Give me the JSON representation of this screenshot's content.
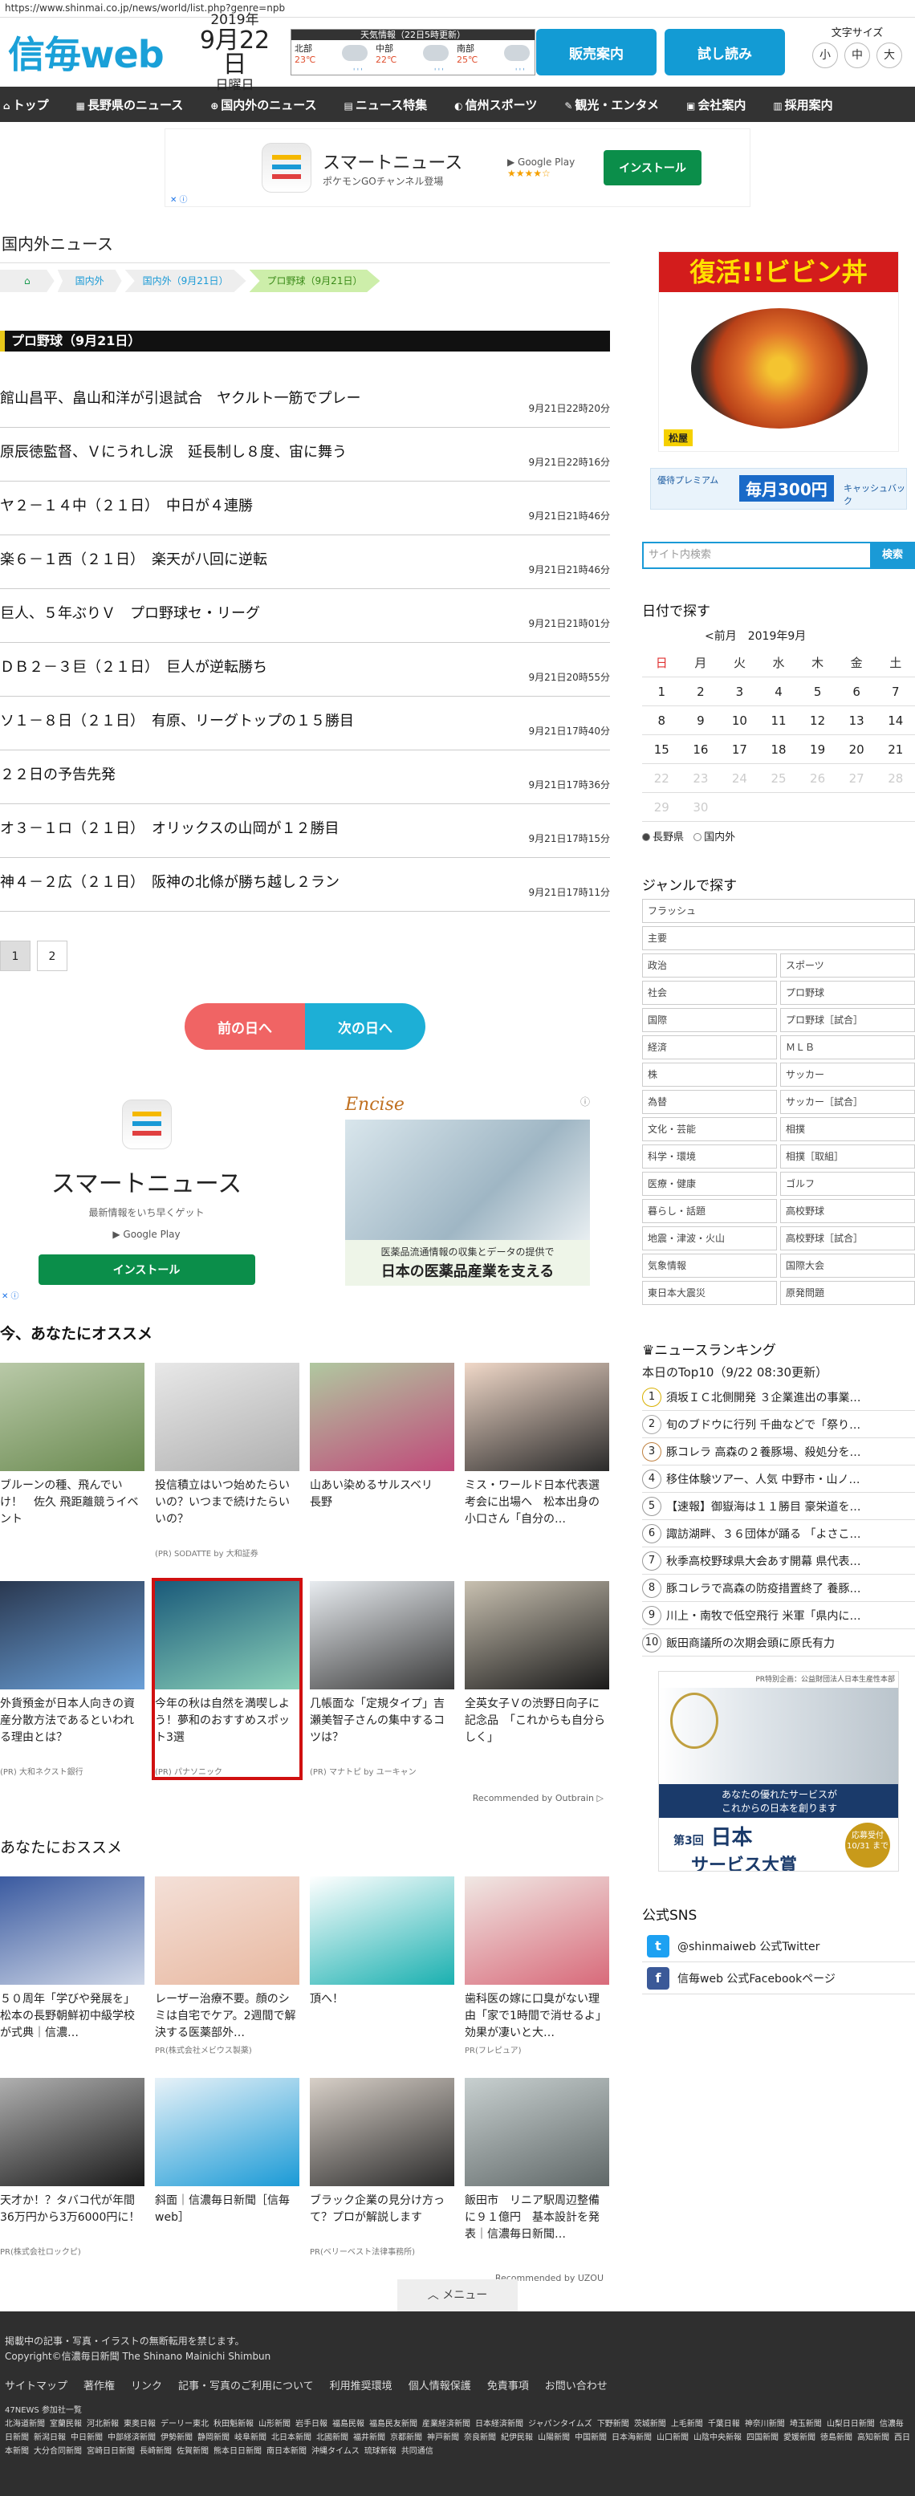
{
  "browser": {
    "url": "https://www.shinmai.co.jp/news/world/list.php?genre=npb"
  },
  "header": {
    "logo": "信毎web",
    "date": {
      "year": "2019年",
      "md": "9月22日",
      "weekday": "日曜日"
    },
    "weather": {
      "title": "天気情報（22日5時更新）",
      "cells": [
        {
          "name": "北部",
          "temp": "23℃"
        },
        {
          "name": "中部",
          "temp": "22℃"
        },
        {
          "name": "南部",
          "temp": "25℃"
        }
      ]
    },
    "btn_shop": "販売案内",
    "btn_trial": "試し読み",
    "font_size": {
      "label": "文字サイズ",
      "small": "小",
      "mid": "中",
      "large": "大"
    }
  },
  "nav": [
    {
      "icon": "home-icon",
      "glyph": "⌂",
      "label": "トップ"
    },
    {
      "icon": "nagano-icon",
      "glyph": "▦",
      "label": "長野県のニュース"
    },
    {
      "icon": "globe-icon",
      "glyph": "⊕",
      "label": "国内外のニュース"
    },
    {
      "icon": "doc-icon",
      "glyph": "▤",
      "label": "ニュース特集"
    },
    {
      "icon": "sports-icon",
      "glyph": "◐",
      "label": "信州スポーツ"
    },
    {
      "icon": "tour-icon",
      "glyph": "✎",
      "label": "観光・エンタメ"
    },
    {
      "icon": "company-icon",
      "glyph": "▣",
      "label": "会社案内"
    },
    {
      "icon": "recruit-icon",
      "glyph": "▥",
      "label": "採用案内"
    }
  ],
  "topad": {
    "title": "スマートニュース",
    "sub": "ポケモンGOチャンネル登場",
    "gplay": "▶ Google Play",
    "stars": "★★★★☆",
    "install": "インストール",
    "adchoice": "✕ ⓘ"
  },
  "main": {
    "section_title": "国内外ニュース",
    "crumbs": [
      "国内外",
      "国内外（9月21日）",
      "プロ野球（9月21日）"
    ],
    "category": "プロ野球（9月21日）",
    "news": [
      {
        "title": "館山昌平、畠山和洋が引退試合　ヤクルト一筋でプレー",
        "time": "9月21日22時20分"
      },
      {
        "title": "原辰徳監督、Ｖにうれし涙　延長制し８度、宙に舞う",
        "time": "9月21日22時16分"
      },
      {
        "title": "ヤ２－１４中（２１日）　中日が４連勝",
        "time": "9月21日21時46分"
      },
      {
        "title": "楽６－１西（２１日）　楽天が八回に逆転",
        "time": "9月21日21時46分"
      },
      {
        "title": "巨人、５年ぶりＶ　プロ野球セ・リーグ",
        "time": "9月21日21時01分"
      },
      {
        "title": "ＤＢ２－３巨（２１日）　巨人が逆転勝ち",
        "time": "9月21日20時55分"
      },
      {
        "title": "ソ１－８日（２１日）　有原、リーグトップの１５勝目",
        "time": "9月21日17時40分"
      },
      {
        "title": "２２日の予告先発",
        "time": "9月21日17時36分"
      },
      {
        "title": "オ３－１ロ（２１日）　オリックスの山岡が１２勝目",
        "time": "9月21日17時15分"
      },
      {
        "title": "神４－２広（２１日）　阪神の北條が勝ち越し２ラン",
        "time": "9月21日17時11分"
      }
    ],
    "pages": [
      "1",
      "2"
    ],
    "prev_day": "前の日へ",
    "next_day": "次の日へ",
    "midad1": {
      "title": "スマートニュース",
      "sub": "最新情報をいち早くゲット",
      "gplay": "▶ Google Play",
      "install": "インストール",
      "adchoice": "✕ ⓘ"
    },
    "midad2": {
      "brand": "Encise",
      "line1": "医薬品流通情報の収集とデータの提供で",
      "line2": "日本の医薬品産業を支える",
      "info": "ⓘ"
    },
    "reco1_title": "今、あなたにオススメ",
    "reco1": [
      {
        "title": "ブルーンの種、飛んでいけ！　佐久 飛距離競うイベント",
        "sponsor": ""
      },
      {
        "title": "投信積立はいつ始めたらいいの？いつまで続けたらいいの？",
        "sponsor": "(PR) SODATTE by 大和証券"
      },
      {
        "title": "山あい染めるサルスベリ　長野",
        "sponsor": ""
      },
      {
        "title": "ミス・ワールド日本代表選考会に出場へ　松本出身の小口さん「自分の…",
        "sponsor": ""
      },
      {
        "title": "外貨預金が日本人向きの資産分散方法であるといわれる理由とは？",
        "sponsor": "(PR) 大和ネクスト銀行"
      },
      {
        "title": "今年の秋は自然を満喫しよう！夢和のおすすめスポット3選",
        "sponsor": "(PR) パナソニック"
      },
      {
        "title": "几帳面な「定規タイプ」吉瀬美智子さんの集中するコツは？",
        "sponsor": "(PR) マナトピ by ユーキャン"
      },
      {
        "title": "全英女子Ｖの渋野日向子に記念品　「これからも自分らしく」",
        "sponsor": ""
      }
    ],
    "reco1_by": "Recommended by Outbrain ▷",
    "reco2_title": "あなたにおススメ",
    "reco2": [
      {
        "title": "５０周年「学びや発展を」 松本の長野朝鮮初中級学校が式典｜信濃…",
        "sponsor": ""
      },
      {
        "title": "レーザー治療不要。顔のシミは自宅でケア。2週間で解決する医薬部外…",
        "sponsor": "PR(株式会社メビウス製薬)"
      },
      {
        "title": "頂へ！",
        "sponsor": ""
      },
      {
        "title": "歯科医の嫁に口臭がない理由「家で1時間で消せるよ」効果が凄いと大…",
        "sponsor": "PR(フレピュア)"
      },
      {
        "title": "天才か！？タバコ代が年間36万円から3万6000円に！",
        "sponsor": "PR(株式会社ロックピ)"
      },
      {
        "title": "斜面｜信濃毎日新聞［信毎web］",
        "sponsor": ""
      },
      {
        "title": "ブラック企業の見分け方って？プロが解説します",
        "sponsor": "PR(ベリーベスト法律事務所)"
      },
      {
        "title": "飯田市　リニア駅周辺整備に９１億円　基本設計を発表｜信濃毎日新聞…",
        "sponsor": ""
      }
    ],
    "reco2_by": "Recommended by UZOU"
  },
  "side": {
    "bigad": {
      "big": "復活!!ビビン丼",
      "brand": "松屋"
    },
    "smallad": {
      "t1": "優待プレミアム",
      "t2": "毎月300円",
      "t3": "キャッシュバック"
    },
    "search_placeholder": "サイト内検索",
    "search_btn": "検索",
    "date_title": "日付で探す",
    "cal_head": "<前月　2019年9月",
    "weekdays": [
      "日",
      "月",
      "火",
      "水",
      "木",
      "金",
      "土"
    ],
    "cal": [
      [
        "1",
        "2",
        "3",
        "4",
        "5",
        "6",
        "7"
      ],
      [
        "8",
        "9",
        "10",
        "11",
        "12",
        "13",
        "14"
      ],
      [
        "15",
        "16",
        "17",
        "18",
        "19",
        "20",
        "21"
      ],
      [
        "22",
        "23",
        "24",
        "25",
        "26",
        "27",
        "28"
      ],
      [
        "29",
        "30",
        "",
        "",
        "",
        "",
        ""
      ]
    ],
    "radio": [
      "長野県",
      "国内外"
    ],
    "genre_title": "ジャンルで探す",
    "genre_full": [
      "フラッシュ",
      "主要"
    ],
    "genre_pairs": [
      [
        "政治",
        "スポーツ"
      ],
      [
        "社会",
        "プロ野球"
      ],
      [
        "国際",
        "プロ野球［試合］"
      ],
      [
        "経済",
        "ＭＬＢ"
      ],
      [
        "株",
        "サッカー"
      ],
      [
        "為替",
        "サッカー［試合］"
      ],
      [
        "文化・芸能",
        "相撲"
      ],
      [
        "科学・環境",
        "相撲［取組］"
      ],
      [
        "医療・健康",
        "ゴルフ"
      ],
      [
        "暮らし・話題",
        "高校野球"
      ],
      [
        "地震・津波・火山",
        "高校野球［試合］"
      ],
      [
        "気象情報",
        "国際大会"
      ],
      [
        "東日本大震災",
        "原発問題"
      ]
    ],
    "rank_title": "ニュースランキング",
    "rank_sub": "本日のTop10（9/22 08:30更新）",
    "rank": [
      "須坂ＩＣ北側開発 ３企業進出の事業…",
      "旬のブドウに行列 千曲などで「祭り…",
      "豚コレラ 高森の２養豚場、殺処分を…",
      "移住体験ツアー、人気 中野市・山ノ…",
      "【速報】御嶽海は１１勝目 豪栄道を…",
      "諏訪湖畔、３６団体が踊る 「よさこ…",
      "秋季高校野球県大会あす開幕 県代表…",
      "豚コレラで高森の防疫措置終了 養豚…",
      "川上・南牧で低空飛行 米軍「県内に…",
      "飯田商議所の次期会頭に原氏有力"
    ],
    "award": {
      "pr": "PR特別企画：公益財団法人日本生産性本部",
      "msg1": "あなたの優れたサービスが",
      "msg2": "これからの日本を創ります",
      "num": "第3回",
      "name1": "日本",
      "name2": "サービス大賞",
      "deadline": "応募受付 10/31 まで"
    },
    "sns_title": "公式SNS",
    "sns": [
      "@shinmaiweb 公式Twitter",
      "信毎web 公式Facebookページ"
    ]
  },
  "footer": {
    "menu": "メニュー",
    "notice": "掲載中の記事・写真・イラストの無断転用を禁じます。",
    "copy": "Copyright©信濃毎日新聞 The Shinano Mainichi Shimbun",
    "links": [
      "サイトマップ",
      "著作権",
      "リンク",
      "記事・写真のご利用について",
      "利用推奨環境",
      "個人情報保護",
      "免責事項",
      "お問い合わせ"
    ],
    "p47": "47NEWS 参加社一覧",
    "papers": [
      "北海道新聞",
      "室蘭民報",
      "河北新報",
      "東奥日報",
      "デーリー東北",
      "秋田魁新報",
      "山形新聞",
      "岩手日報",
      "福島民報",
      "福島民友新聞",
      "産業経済新聞",
      "日本経済新聞",
      "ジャパンタイムズ",
      "下野新聞",
      "茨城新聞",
      "上毛新聞",
      "千葉日報",
      "神奈川新聞",
      "埼玉新聞",
      "山梨日日新聞",
      "信濃毎日新聞",
      "新潟日報",
      "中日新聞",
      "中部経済新聞",
      "伊勢新聞",
      "静岡新聞",
      "岐阜新聞",
      "北日本新聞",
      "北國新聞",
      "福井新聞",
      "京都新聞",
      "神戸新聞",
      "奈良新聞",
      "紀伊民報",
      "山陽新聞",
      "中国新聞",
      "日本海新聞",
      "山口新聞",
      "山陰中央新報",
      "四国新聞",
      "愛媛新聞",
      "徳島新聞",
      "高知新聞",
      "西日本新聞",
      "大分合同新聞",
      "宮崎日日新聞",
      "長崎新聞",
      "佐賀新聞",
      "熊本日日新聞",
      "南日本新聞",
      "沖縄タイムス",
      "琉球新報",
      "共同通信"
    ]
  }
}
